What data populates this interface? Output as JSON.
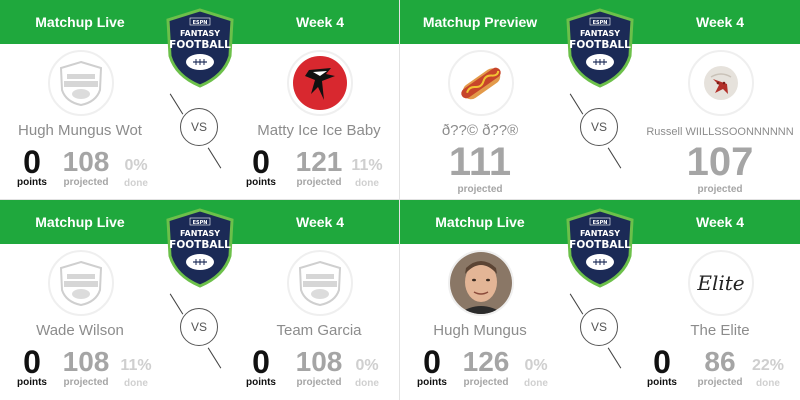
{
  "matchups": [
    {
      "status": "Matchup Live",
      "week": "Week 4",
      "logo": "espn-fantasy-football-logo",
      "vs": "VS",
      "left": {
        "name": "Hugh Mungus Wot",
        "avatar": "default-fantasy-football-icon",
        "points": "0",
        "points_label": "points",
        "projected": "108",
        "projected_label": "projected",
        "done": "0%",
        "done_label": "done"
      },
      "right": {
        "name": "Matty Ice Ice Baby",
        "avatar": "falcons-icon",
        "points": "0",
        "points_label": "points",
        "projected": "121",
        "projected_label": "projected",
        "done": "11%",
        "done_label": "done"
      }
    },
    {
      "status": "Matchup Preview",
      "week": "Week 4",
      "logo": "espn-fantasy-football-logo",
      "vs": "VS",
      "left": {
        "name": "ð??© ð??®",
        "avatar": "hotdog-icon",
        "projected": "111",
        "projected_label": "projected"
      },
      "right": {
        "name": "Russell WIILLSSOONNNNNN",
        "avatar": "volleyball-face-icon",
        "projected": "107",
        "projected_label": "projected"
      }
    },
    {
      "status": "Matchup Live",
      "week": "Week 4",
      "logo": "espn-fantasy-football-logo",
      "vs": "VS",
      "left": {
        "name": "Wade Wilson",
        "avatar": "default-fantasy-football-icon",
        "points": "0",
        "points_label": "points",
        "projected": "108",
        "projected_label": "projected",
        "done": "11%",
        "done_label": "done"
      },
      "right": {
        "name": "Team Garcia",
        "avatar": "default-fantasy-football-icon",
        "points": "0",
        "points_label": "points",
        "projected": "108",
        "projected_label": "projected",
        "done": "0%",
        "done_label": "done"
      }
    },
    {
      "status": "Matchup Live",
      "week": "Week 4",
      "logo": "espn-fantasy-football-logo",
      "vs": "VS",
      "left": {
        "name": "Hugh Mungus",
        "avatar": "photo-avatar",
        "points": "0",
        "points_label": "points",
        "projected": "126",
        "projected_label": "projected",
        "done": "0%",
        "done_label": "done"
      },
      "right": {
        "name": "The Elite",
        "avatar": "elite-script-logo",
        "logo_text": "Elite",
        "points": "0",
        "points_label": "points",
        "projected": "86",
        "projected_label": "projected",
        "done": "22%",
        "done_label": "done"
      }
    }
  ],
  "colors": {
    "header_green": "#1fa83d",
    "logo_navy": "#1b2a56",
    "logo_green": "#6cc04a",
    "falcons_red": "#d8282f"
  }
}
